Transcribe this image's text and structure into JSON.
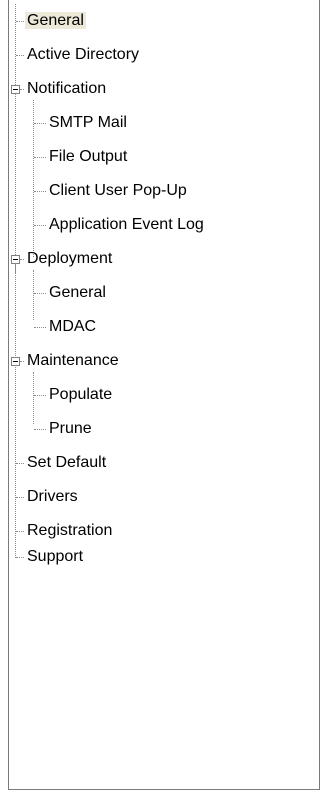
{
  "tree": {
    "items": [
      {
        "label": "General",
        "selected": true
      },
      {
        "label": "Active Directory"
      },
      {
        "label": "Notification",
        "expanded": true,
        "children": [
          {
            "label": "SMTP Mail"
          },
          {
            "label": "File Output"
          },
          {
            "label": "Client User Pop-Up"
          },
          {
            "label": "Application Event Log"
          }
        ]
      },
      {
        "label": "Deployment",
        "expanded": true,
        "children": [
          {
            "label": "General"
          },
          {
            "label": "MDAC"
          }
        ]
      },
      {
        "label": "Maintenance",
        "expanded": true,
        "children": [
          {
            "label": "Populate"
          },
          {
            "label": "Prune"
          }
        ]
      },
      {
        "label": "Set Default"
      },
      {
        "label": "Drivers"
      },
      {
        "label": "Registration"
      },
      {
        "label": "Support"
      }
    ]
  },
  "colors": {
    "selection": "#ece9d8",
    "connector": "#8a8a8a",
    "border": "#7a7a7a"
  },
  "icons": {
    "expander": "collapse-minus-icon"
  }
}
